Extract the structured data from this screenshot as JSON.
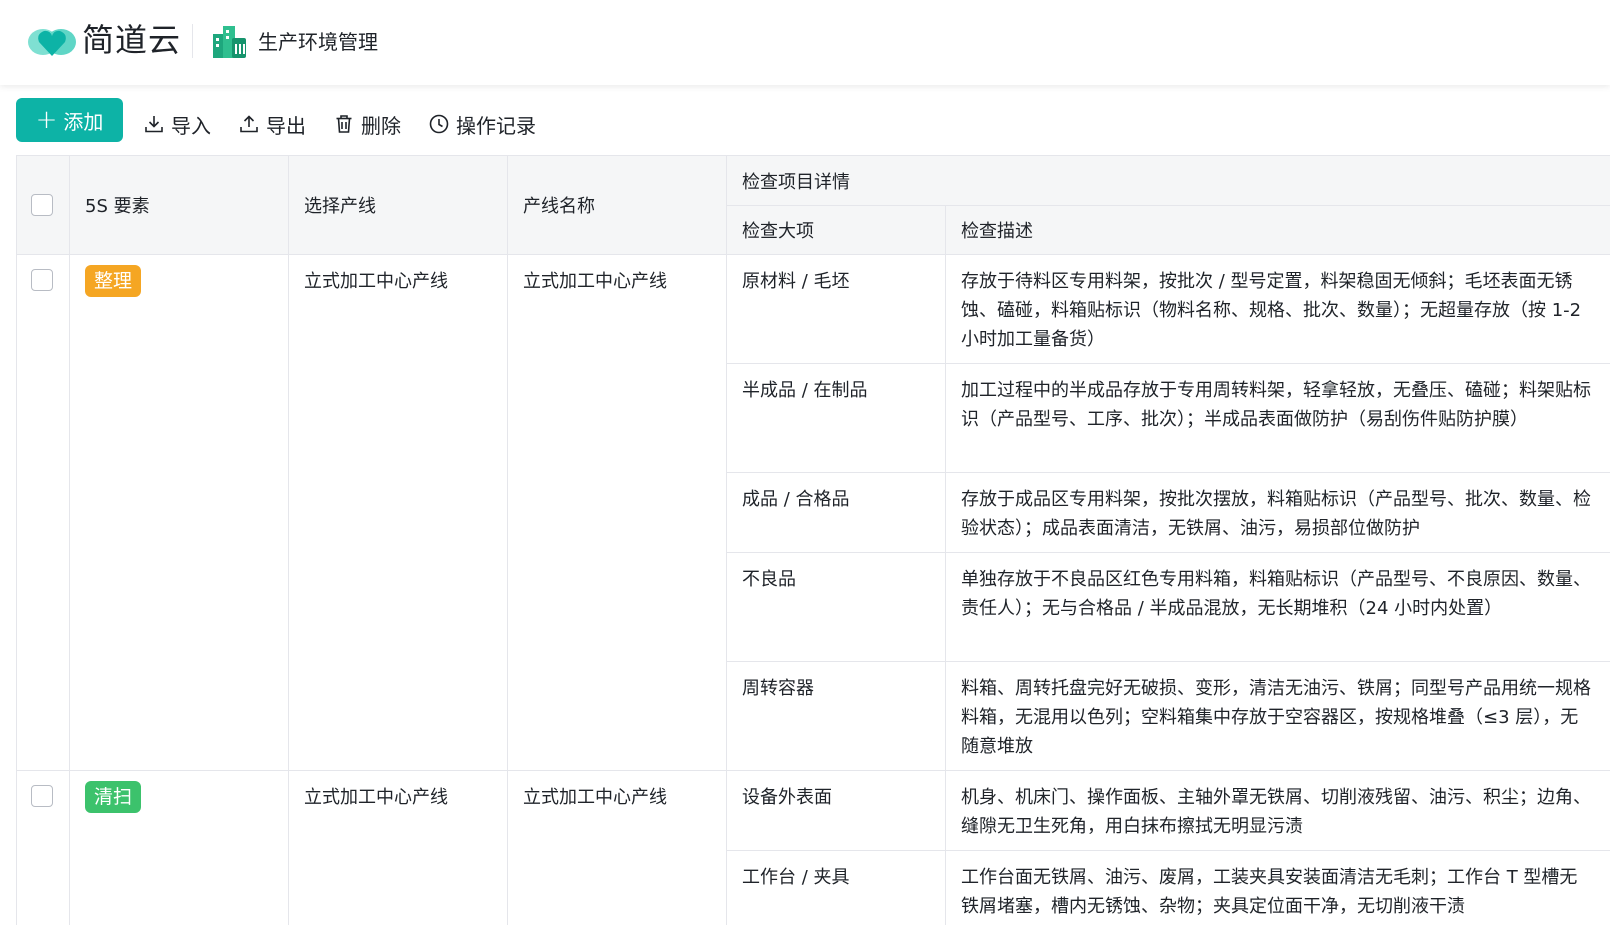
{
  "header": {
    "brand": "简道云",
    "app_title": "生产环境管理",
    "brand_color": "#0db3a6"
  },
  "toolbar": {
    "add_label": "添加",
    "import_label": "导入",
    "export_label": "导出",
    "delete_label": "删除",
    "log_label": "操作记录"
  },
  "table": {
    "headers": {
      "element": "5S 要素",
      "select_line": "选择产线",
      "line_name": "产线名称",
      "group": "检查项目详情",
      "item": "检查大项",
      "desc": "检查描述"
    },
    "groups": [
      {
        "tag": "整理",
        "tag_color": "#f5a623",
        "select_line": "立式加工中心产线",
        "line_name": "立式加工中心产线",
        "rows": [
          {
            "item": "原材料 / 毛坯",
            "desc": "存放于待料区专用料架，按批次 / 型号定置，料架稳固无倾斜；毛坯表面无锈蚀、磕碰，料箱贴标识（物料名称、规格、批次、数量）；无超量存放（按 1-2 小时加工量备货）"
          },
          {
            "item": "半成品 / 在制品",
            "desc": "加工过程中的半成品存放于专用周转料架，轻拿轻放，无叠压、磕碰；料架贴标识（产品型号、工序、批次）；半成品表面做防护（易刮伤件贴防护膜）"
          },
          {
            "item": "成品 / 合格品",
            "desc": "存放于成品区专用料架，按批次摆放，料箱贴标识（产品型号、批次、数量、检验状态）；成品表面清洁，无铁屑、油污，易损部位做防护"
          },
          {
            "item": "不良品",
            "desc": "单独存放于不良品区红色专用料箱，料箱贴标识（产品型号、不良原因、数量、责任人）；无与合格品 / 半成品混放，无长期堆积（24 小时内处置）"
          },
          {
            "item": "周转容器",
            "desc": "料箱、周转托盘完好无破损、变形，清洁无油污、铁屑；同型号产品用统一规格料箱，无混用以色列；空料箱集中存放于空容器区，按规格堆叠（≤3 层），无随意堆放"
          }
        ]
      },
      {
        "tag": "清扫",
        "tag_color": "#3cc26c",
        "select_line": "立式加工中心产线",
        "line_name": "立式加工中心产线",
        "rows": [
          {
            "item": "设备外表面",
            "desc": "机身、机床门、操作面板、主轴外罩无铁屑、切削液残留、油污、积尘；边角、缝隙无卫生死角，用白抹布擦拭无明显污渍"
          },
          {
            "item": "工作台 / 夹具",
            "desc": "工作台面无铁屑、油污、废屑，工装夹具安装面清洁无毛刺；工作台 T 型槽无铁屑堵塞，槽内无锈蚀、杂物；夹具定位面干净，无切削液干渍"
          }
        ]
      }
    ]
  }
}
